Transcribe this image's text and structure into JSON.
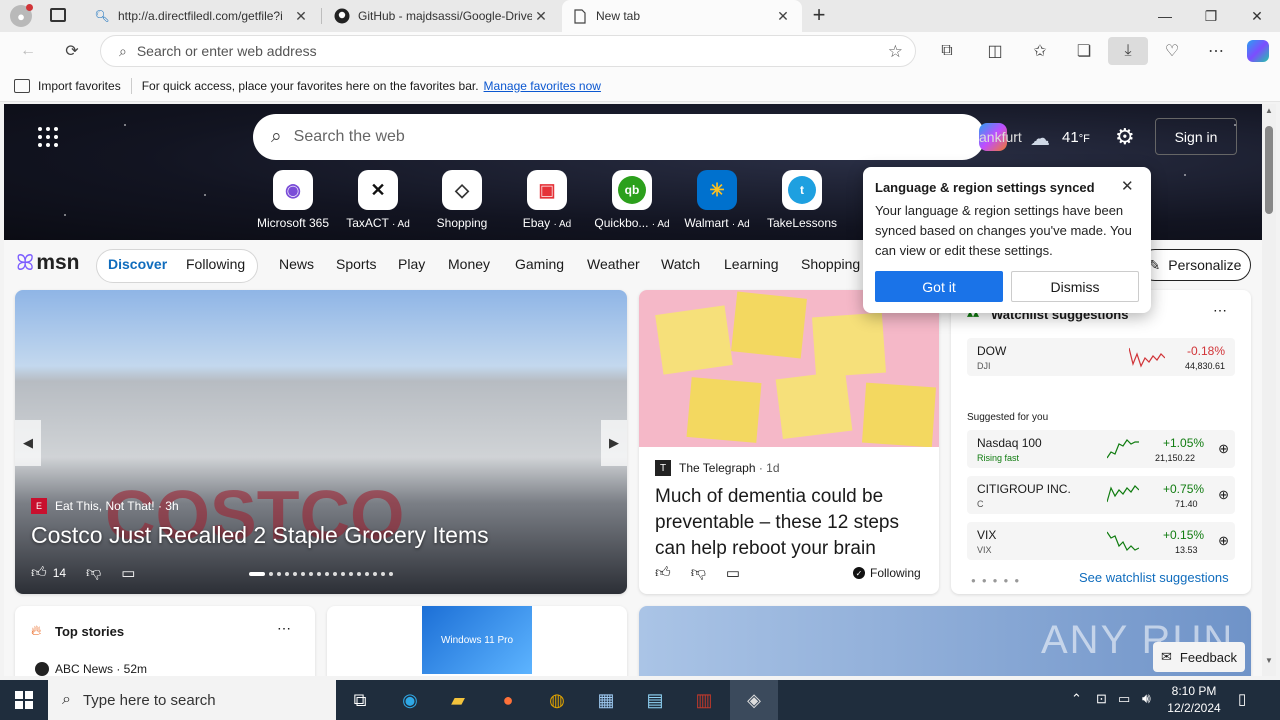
{
  "tabs": [
    {
      "title": "http://a.directfiledl.com/getfile?i"
    },
    {
      "title": "GitHub - majdsassi/Google-Drive"
    },
    {
      "title": "New tab"
    }
  ],
  "address": {
    "placeholder": "Search or enter web address"
  },
  "favbar": {
    "import_label": "Import favorites",
    "hint": "For quick access, place your favorites here on the favorites bar.",
    "manage_link": "Manage favorites now"
  },
  "msn": {
    "search_placeholder": "Search the web",
    "location": "ankfurt",
    "temperature": "41",
    "temp_unit": "°F",
    "sign_in": "Sign in",
    "quick_links": [
      {
        "label": "Microsoft 365",
        "ad": ""
      },
      {
        "label": "TaxACT",
        "ad": "· Ad"
      },
      {
        "label": "Shopping",
        "ad": ""
      },
      {
        "label": "Ebay",
        "ad": "· Ad"
      },
      {
        "label": "Quickbo...",
        "ad": "· Ad"
      },
      {
        "label": "Walmart",
        "ad": "· Ad"
      },
      {
        "label": "TakeLessons",
        "ad": ""
      }
    ],
    "logo": "msn",
    "feed_tabs": [
      "Discover",
      "Following"
    ],
    "nav": [
      "News",
      "Sports",
      "Play",
      "Money",
      "Gaming",
      "Weather",
      "Watch",
      "Learning",
      "Shopping"
    ],
    "personalize": "Personalize"
  },
  "hero_story": {
    "source": "Eat This, Not That!",
    "age": "· 3h",
    "headline": "Costco Just Recalled 2 Staple Grocery Items",
    "likes": "14"
  },
  "second_story": {
    "source": "The Telegraph",
    "age": "· 1d",
    "headline": "Much of dementia could be preventable – these 12 steps can help reboot your brain",
    "following": "Following"
  },
  "watchlist": {
    "title": "Watchlist suggestions",
    "suggested_label": "Suggested for you",
    "see_link": "See watchlist suggestions",
    "items": [
      {
        "name": "DOW",
        "ticker": "DJI",
        "change": "-0.18%",
        "price": "44,830.61",
        "color": "#d13438"
      },
      {
        "name": "Nasdaq 100",
        "ticker": "Rising fast",
        "change": "+1.05%",
        "price": "21,150.22",
        "color": "#107c10"
      },
      {
        "name": "CITIGROUP INC.",
        "ticker": "C",
        "change": "+0.75%",
        "price": "71.40",
        "color": "#107c10"
      },
      {
        "name": "VIX",
        "ticker": "VIX",
        "change": "+0.15%",
        "price": "13.53",
        "color": "#107c10"
      }
    ]
  },
  "popup": {
    "title": "Language & region settings synced",
    "body": "Your language & region settings have been synced based on changes you've made. You can view or edit these settings.",
    "got_it": "Got it",
    "dismiss": "Dismiss"
  },
  "bottom": {
    "top_stories": "Top stories",
    "first_source": "ABC News · 52m",
    "product_label": "Windows 11 Pro",
    "feedback": "Feedback",
    "watermark": "ANY RUN"
  },
  "taskbar": {
    "search_placeholder": "Type here to search",
    "time": "8:10 PM",
    "date": "12/2/2024"
  },
  "colors": {
    "accent": "#0f6cbd",
    "popup_button": "#1a73e8"
  }
}
